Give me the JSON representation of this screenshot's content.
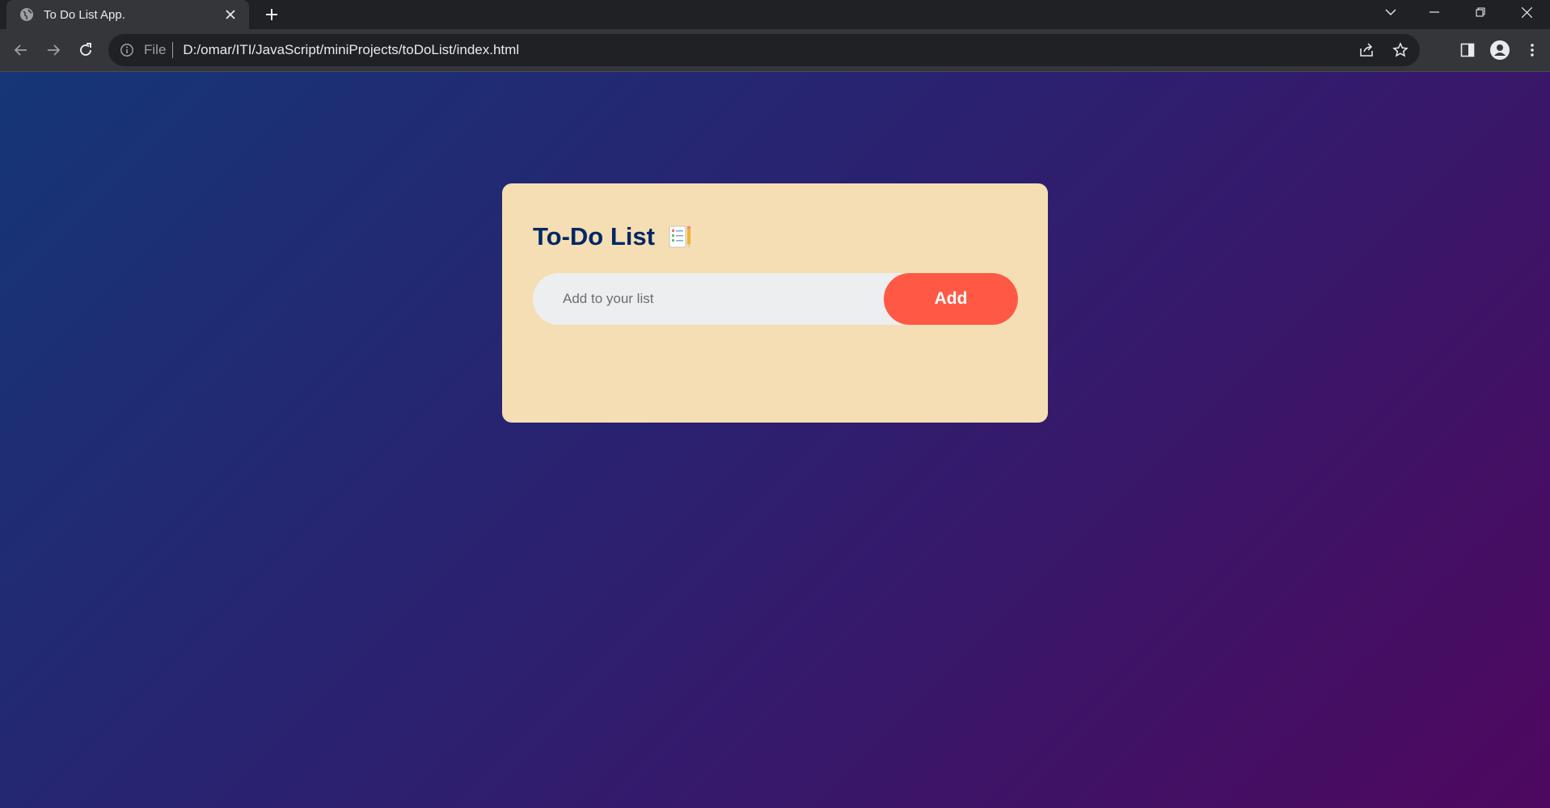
{
  "browser": {
    "tab": {
      "title": "To Do List App.",
      "favicon": "globe-icon",
      "close_icon": "close-icon"
    },
    "new_tab_icon": "plus-icon",
    "window_controls": [
      "chevron-down-icon",
      "minimize-icon",
      "restore-icon",
      "close-icon"
    ],
    "toolbar": {
      "back_icon": "arrow-left-icon",
      "forward_icon": "arrow-right-icon",
      "reload_icon": "reload-icon",
      "address": {
        "info_icon": "info-icon",
        "scheme": "File",
        "url": "D:/omar/ITI/JavaScript/miniProjects/toDoList/index.html"
      },
      "right_icons": [
        "share-icon",
        "star-icon",
        "side-panel-icon",
        "profile-icon",
        "kebab-menu-icon"
      ]
    }
  },
  "app": {
    "title": "To-Do List",
    "title_icon": "notepad-icon",
    "input": {
      "placeholder": "Add to your list",
      "value": ""
    },
    "add_button_label": "Add"
  },
  "colors": {
    "gradient": [
      "#153677",
      "#4e085f"
    ],
    "card_background": "#f5deb3",
    "heading": "#002765",
    "input_background": "#edeef0",
    "button": "#ff5945"
  }
}
